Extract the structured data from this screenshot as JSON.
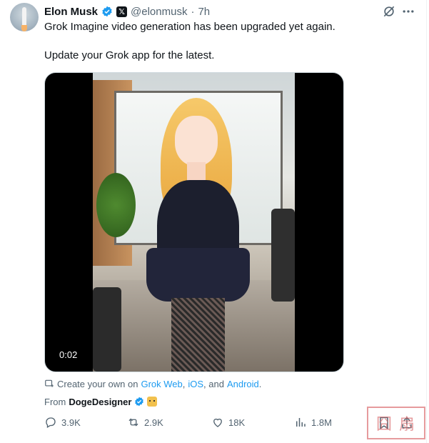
{
  "author": {
    "name": "Elon Musk",
    "handle": "@elonmusk",
    "separator": "·",
    "time": "7h"
  },
  "tweet": {
    "line1": "Grok Imagine video generation has been upgraded yet again.",
    "line2": "Update your Grok app for the latest."
  },
  "media": {
    "duration": "0:02"
  },
  "create": {
    "prefix": "Create your own on",
    "link_web": "Grok Web",
    "comma": ",",
    "link_ios": "iOS",
    "and_text": ", and",
    "link_android": "Android",
    "period": "."
  },
  "from": {
    "label": "From",
    "source": "DogeDesigner"
  },
  "stats": {
    "replies": "3.9K",
    "reposts": "2.9K",
    "likes": "18K",
    "views": "1.8M"
  },
  "watermark": {
    "text": "囧 扇"
  },
  "colors": {
    "verified": "#1d9bf0",
    "link": "#1d9bf0",
    "secondary_text": "#536471"
  },
  "icons": [
    "verified-icon",
    "x-badge-icon",
    "grok-icon",
    "more-icon",
    "create-icon",
    "reply-icon",
    "repost-icon",
    "like-icon",
    "views-icon",
    "bookmark-icon",
    "share-icon"
  ]
}
